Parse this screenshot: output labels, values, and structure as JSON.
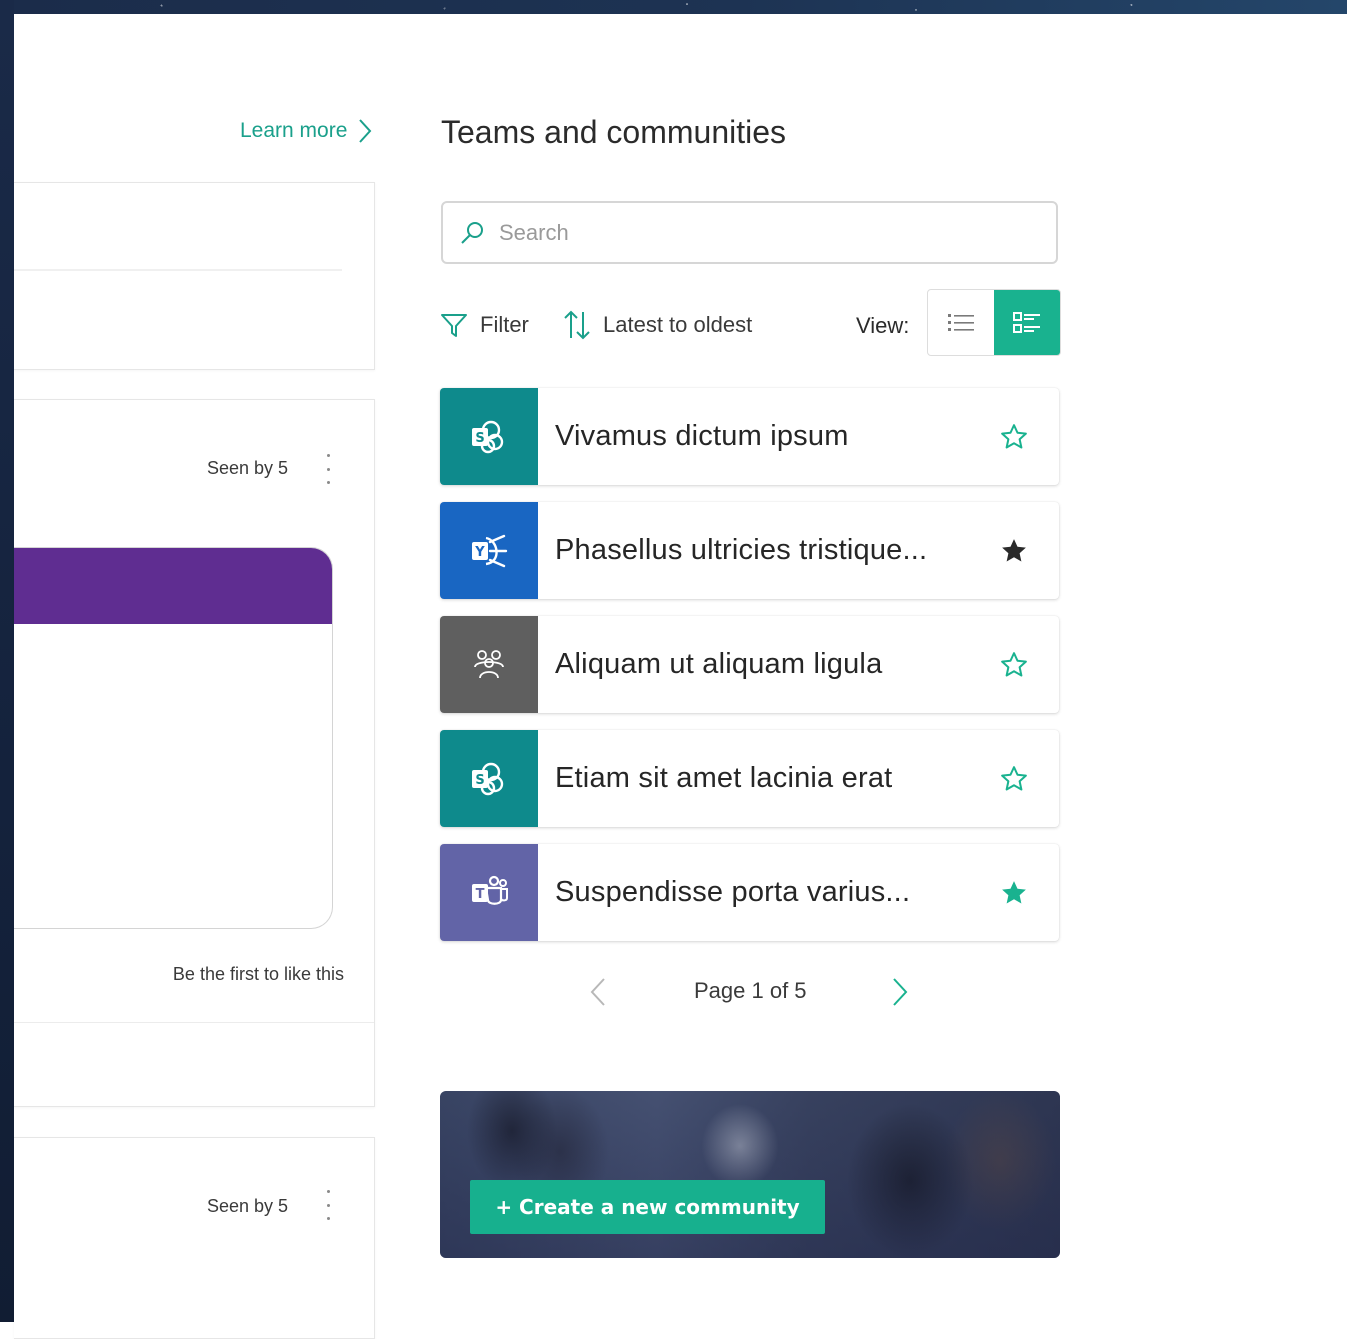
{
  "colors": {
    "accent": "#19b28f",
    "link": "#1aa08b",
    "sharepoint": "#0e8a8c",
    "yammer": "#1966c2",
    "generic_group": "#5f5f5f",
    "teams": "#6264a7",
    "media_header": "#5f2d91"
  },
  "feed": {
    "learn_more": "Learn more",
    "posts": [
      {
        "seen": "Seen by 5",
        "likes": "Be the first to like this"
      },
      {
        "seen": "Seen by 5"
      }
    ]
  },
  "panel": {
    "title": "Teams and communities",
    "search_placeholder": "Search",
    "filter_label": "Filter",
    "sort_label": "Latest to oldest",
    "view_label": "View:",
    "view_modes": [
      "list-view-icon",
      "tile-view-icon"
    ],
    "active_view": "tile",
    "communities": [
      {
        "title": "Vivamus dictum ipsum",
        "type": "sharepoint",
        "icon": "sharepoint-icon",
        "favorite": false
      },
      {
        "title": "Phasellus ultricies tristique...",
        "type": "yammer",
        "icon": "yammer-icon",
        "favorite": true
      },
      {
        "title": "Aliquam ut aliquam ligula",
        "type": "group",
        "icon": "group-icon",
        "favorite": false
      },
      {
        "title": "Etiam sit amet lacinia erat",
        "type": "sharepoint",
        "icon": "sharepoint-icon",
        "favorite": false
      },
      {
        "title": "Suspendisse porta varius...",
        "type": "teams",
        "icon": "teams-icon",
        "favorite": true
      }
    ],
    "pagination": {
      "text": "Page 1 of 5",
      "current": 1,
      "total": 5
    },
    "create_button": "+ Create a new community"
  }
}
